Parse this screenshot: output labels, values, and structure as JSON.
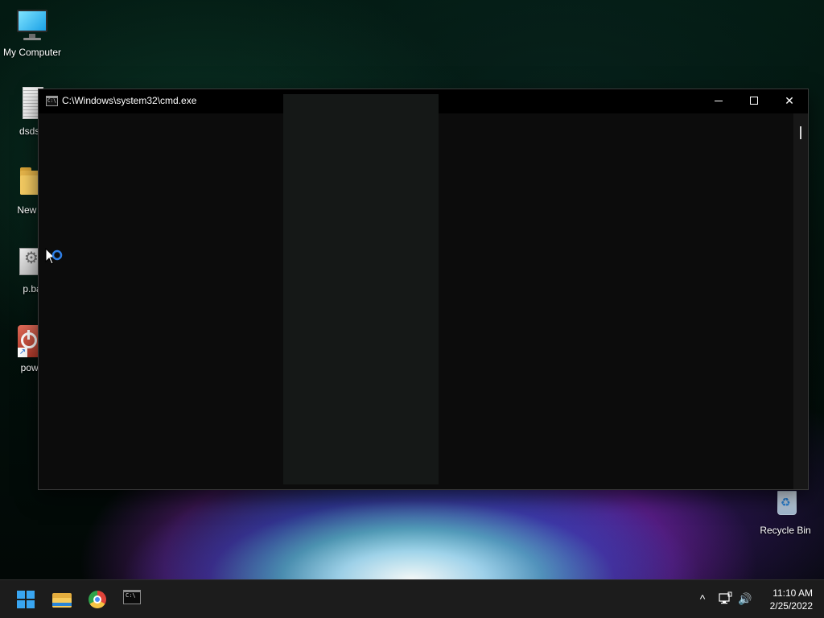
{
  "desktop": {
    "icons": [
      {
        "label": "My Computer",
        "icon": "monitor-icon"
      },
      {
        "label": "dsds.t",
        "icon": "text-file-icon"
      },
      {
        "label": "New fo",
        "icon": "folder-icon"
      },
      {
        "label": "p.ba",
        "icon": "batch-file-icon"
      },
      {
        "label": "powe",
        "icon": "power-shortcut-icon"
      },
      {
        "label": "Recycle Bin",
        "icon": "recycle-bin-icon"
      }
    ]
  },
  "window": {
    "title": "C:\\Windows\\system32\\cmd.exe",
    "icon_text": "C:\\",
    "controls": {
      "minimize": "minimize-icon",
      "maximize": "maximize-icon",
      "close": "✕"
    },
    "console_text": ""
  },
  "taskbar": {
    "items": [
      "start-icon",
      "file-explorer-icon",
      "chrome-icon",
      "cmd-icon"
    ],
    "cmd_icon_text": "C:\\",
    "tray": {
      "chevron": "^",
      "volume": "🔊"
    },
    "clock": {
      "time": "11:10 AM",
      "date": "2/25/2022"
    }
  },
  "colors": {
    "accent": "#39a6f2",
    "console_bg": "#0c0c0c",
    "taskbar_bg": "#1c1c1c"
  }
}
